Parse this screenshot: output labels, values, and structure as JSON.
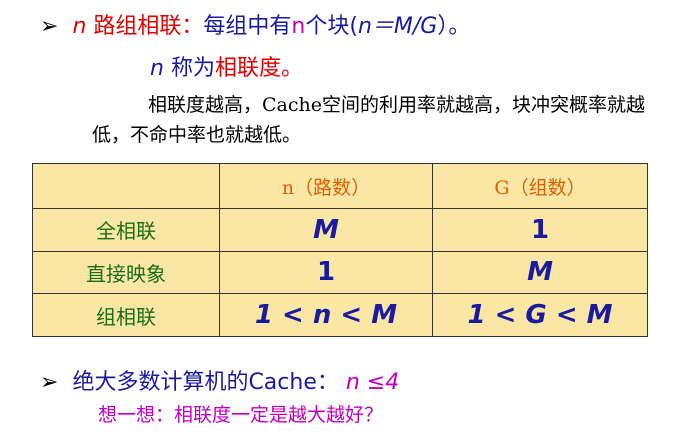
{
  "bullet1": {
    "n": "n",
    "title": "路组相联：",
    "desc": "每组中有",
    "n2": "n",
    "unit": "个块(",
    "formula": "n＝M/G",
    "close": "）。"
  },
  "line2": {
    "n": "n",
    "text": "称为",
    "term": "相联度。"
  },
  "paragraph": "相联度越高，Cache空间的利用率就越高，块冲突概率就越低，不命中率也就越低。",
  "table": {
    "headers": [
      "",
      "n（路数）",
      "G（组数）"
    ],
    "rows": [
      {
        "label": "全相联",
        "n": "M",
        "g": "1"
      },
      {
        "label": "直接映象",
        "n": "1",
        "g": "M"
      },
      {
        "label": "组相联",
        "n": "1 < n < M",
        "g": "1 < G < M"
      }
    ]
  },
  "bullet2": {
    "text": "绝大多数计算机的Cache：",
    "value": "n ≤4"
  },
  "question": "想一想：相联度一定是越大越好？"
}
